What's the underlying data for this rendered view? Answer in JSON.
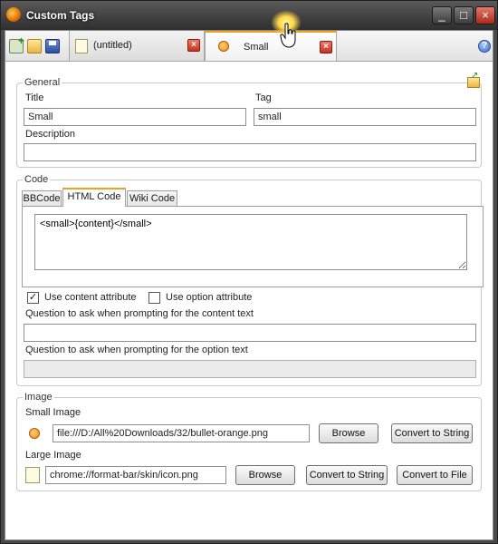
{
  "window": {
    "title": "Custom Tags",
    "min_glyph": "_",
    "max_glyph": "□",
    "close_glyph": "×"
  },
  "tabs": [
    {
      "label": "(untitled)",
      "icon": "pencil-icon",
      "close_glyph": "×"
    },
    {
      "label": "Small",
      "icon": "bullet-orange-icon",
      "close_glyph": "×"
    }
  ],
  "help_glyph": "?",
  "general": {
    "legend": "General",
    "title_label": "Title",
    "title_value": "Small",
    "tag_label": "Tag",
    "tag_value": "small",
    "description_label": "Description",
    "description_value": ""
  },
  "code": {
    "legend": "Code",
    "tabs": [
      "BBCode",
      "HTML Code",
      "Wiki Code"
    ],
    "active_tab": "HTML Code",
    "html_value": "<small>{content}</small>",
    "use_content_label": "Use content attribute",
    "use_content_checked": true,
    "check_glyph": "✓",
    "use_option_label": "Use option attribute",
    "use_option_checked": false,
    "content_question_label": "Question to ask when prompting for the content text",
    "content_question_value": "",
    "option_question_label": "Question to ask when prompting for the option text",
    "option_question_value": ""
  },
  "image": {
    "legend": "Image",
    "small_label": "Small Image",
    "small_path": "file:///D:/All%20Downloads/32/bullet-orange.png",
    "large_label": "Large Image",
    "large_path": "chrome://format-bar/skin/icon.png",
    "browse_label": "Browse",
    "convert_string_label": "Convert to String",
    "convert_file_label": "Convert to File"
  },
  "colors": {
    "accent_tab": "#f0a020",
    "close_red": "#c8321f"
  }
}
